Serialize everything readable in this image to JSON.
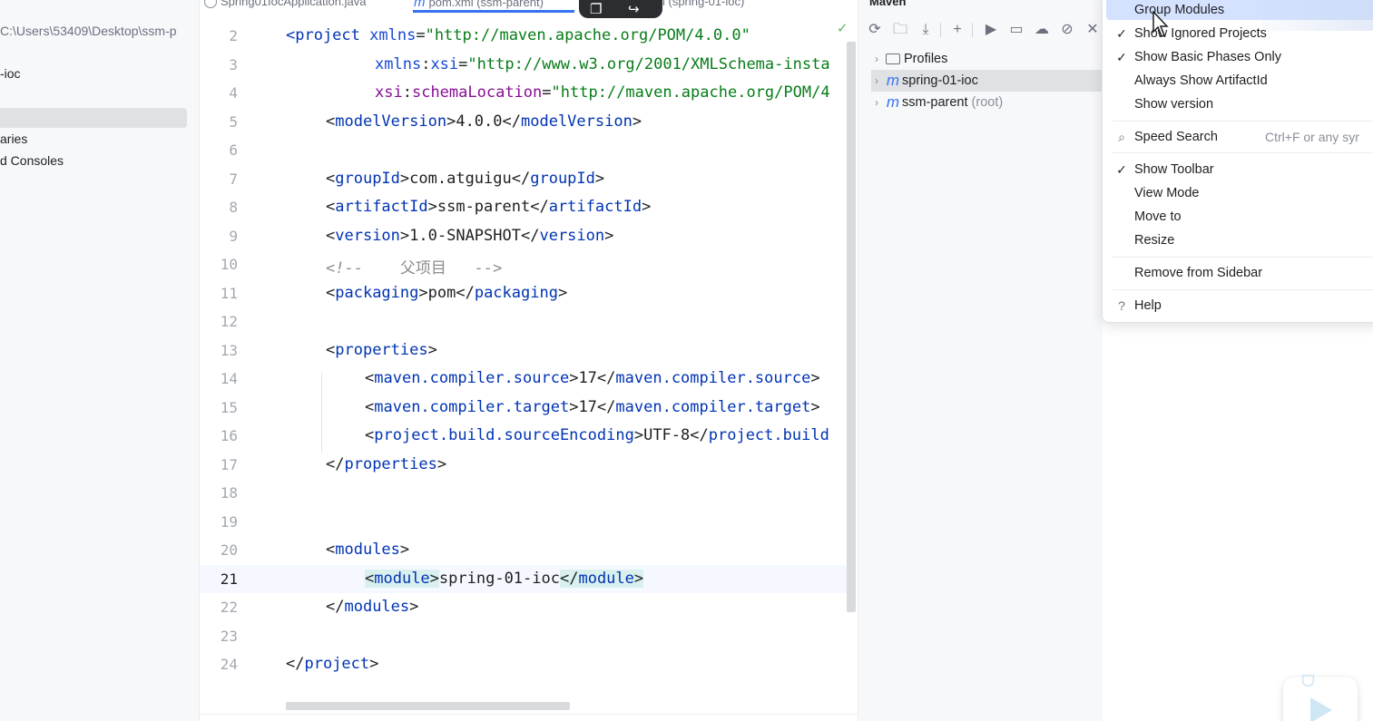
{
  "project_panel": {
    "path": "C:\\Users\\53409\\Desktop\\ssm-p",
    "items": [
      "-ioc",
      "aries",
      "d Consoles"
    ]
  },
  "editor_tabs": [
    {
      "label": "Spring01IocApplication.java",
      "icon": "java-class-icon"
    },
    {
      "label": "pom.xml (ssm-parent)",
      "icon": "maven-icon",
      "active": true
    },
    {
      "label": "l (spring-01-ioc)",
      "icon": "maven-icon"
    }
  ],
  "editor": {
    "current_line": 21,
    "lines": [
      {
        "no": "2"
      },
      {
        "no": "3"
      },
      {
        "no": "4"
      },
      {
        "no": "5"
      },
      {
        "no": "6"
      },
      {
        "no": "7"
      },
      {
        "no": "8"
      },
      {
        "no": "9"
      },
      {
        "no": "10"
      },
      {
        "no": "11"
      },
      {
        "no": "12"
      },
      {
        "no": "13"
      },
      {
        "no": "14"
      },
      {
        "no": "15"
      },
      {
        "no": "16"
      },
      {
        "no": "17"
      },
      {
        "no": "18"
      },
      {
        "no": "19"
      },
      {
        "no": "20"
      },
      {
        "no": "21"
      },
      {
        "no": "22"
      },
      {
        "no": "23"
      },
      {
        "no": "24"
      }
    ],
    "code": {
      "l2_tag": "<project",
      "l2_attr": "xmlns",
      "l2_val": "\"http://maven.apache.org/POM/4.0.0\"",
      "l3_ns": "xmlns",
      "l3_attr": "xsi",
      "l3_val": "\"http://www.w3.org/2001/XMLSchema-insta",
      "l4_ns": "xsi",
      "l4_attr": "schemaLocation",
      "l4_val": "\"http://maven.apache.org/POM/4",
      "model_version": "4.0.0",
      "group_id": "com.atguigu",
      "artifact_id": "ssm-parent",
      "version": "1.0-SNAPSHOT",
      "comment_open": "<!--",
      "comment_text": "父项目",
      "comment_close": "-->",
      "packaging": "pom",
      "compiler_source": "17",
      "compiler_target": "17",
      "encoding": "UTF-8",
      "module": "spring-01-ioc"
    }
  },
  "maven": {
    "title": "Maven",
    "toolbar": [
      "reload-icon",
      "add-folder-icon",
      "download-icon",
      "plus-icon",
      "run-icon",
      "execute-goal-icon",
      "offline-icon",
      "skip-tests-icon",
      "collapse-icon"
    ],
    "tree": [
      {
        "label": "Profiles",
        "icon": "folder-icon"
      },
      {
        "label": "spring-01-ioc",
        "icon": "maven-icon",
        "selected": true
      },
      {
        "label": "ssm-parent",
        "suffix": "(root)",
        "icon": "maven-icon"
      }
    ]
  },
  "menu": {
    "items": [
      {
        "label": "Group Modules",
        "checked": false,
        "hovered": true
      },
      {
        "label": "Show Ignored Projects",
        "checked": true
      },
      {
        "label": "Show Basic Phases Only",
        "checked": true
      },
      {
        "label": "Always Show ArtifactId",
        "checked": false
      },
      {
        "label": "Show version",
        "checked": false
      },
      {
        "label": "Speed Search",
        "shortcut": "Ctrl+F or any syr",
        "icon": "search-icon"
      },
      {
        "label": "Show Toolbar",
        "checked": true
      },
      {
        "label": "View Mode"
      },
      {
        "label": "Move to"
      },
      {
        "label": "Resize"
      },
      {
        "label": "Remove from Sidebar"
      },
      {
        "label": "Help",
        "icon": "help-icon"
      }
    ]
  },
  "colors": {
    "accent": "#3574f0",
    "tag": "#0033b3",
    "string": "#067d17",
    "comment": "#8c8c8c",
    "menu_hover": "#d4e2ff"
  }
}
